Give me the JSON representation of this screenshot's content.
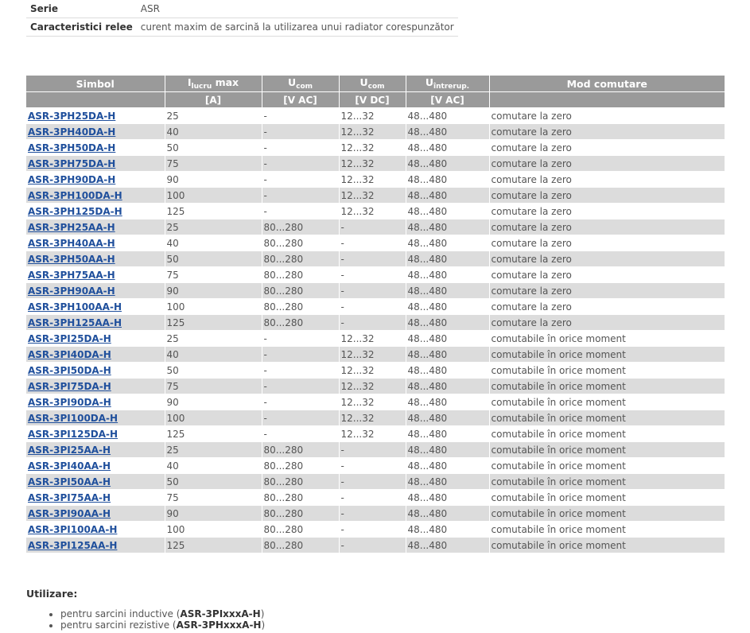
{
  "info": [
    {
      "label": "Serie",
      "value": "ASR"
    },
    {
      "label": "Caracteristici relee",
      "value": "curent maxim de sarcină la utilizarea unui radiator corespunzător"
    }
  ],
  "table": {
    "headers": {
      "simbol": "Simbol",
      "ilucru_main": "I",
      "ilucru_sub": "lucru",
      "ilucru_suffix": " max",
      "ucom_ac_main": "U",
      "ucom_ac_sub": "com",
      "ucom_dc_main": "U",
      "ucom_dc_sub": "com",
      "uintrerup_main": "U",
      "uintrerup_sub": "întrerup.",
      "mod": "Mod comutare"
    },
    "units": [
      "",
      "[A]",
      "[V AC]",
      "[V DC]",
      "[V AC]",
      ""
    ],
    "rows": [
      [
        "ASR-3PH25DA-H",
        "25",
        "-",
        "12...32",
        "48...480",
        "comutare la zero"
      ],
      [
        "ASR-3PH40DA-H",
        "40",
        "-",
        "12...32",
        "48...480",
        "comutare la zero"
      ],
      [
        "ASR-3PH50DA-H",
        "50",
        "-",
        "12...32",
        "48...480",
        "comutare la zero"
      ],
      [
        "ASR-3PH75DA-H",
        "75",
        "-",
        "12...32",
        "48...480",
        "comutare la zero"
      ],
      [
        "ASR-3PH90DA-H",
        "90",
        "-",
        "12...32",
        "48...480",
        "comutare la zero"
      ],
      [
        "ASR-3PH100DA-H",
        "100",
        "-",
        "12...32",
        "48...480",
        "comutare la zero"
      ],
      [
        "ASR-3PH125DA-H",
        "125",
        "-",
        "12...32",
        "48...480",
        "comutare la zero"
      ],
      [
        "ASR-3PH25AA-H",
        "25",
        "80...280",
        "-",
        "48...480",
        "comutare la zero"
      ],
      [
        "ASR-3PH40AA-H",
        "40",
        "80...280",
        "-",
        "48...480",
        "comutare la zero"
      ],
      [
        "ASR-3PH50AA-H",
        "50",
        "80...280",
        "-",
        "48...480",
        "comutare la zero"
      ],
      [
        "ASR-3PH75AA-H",
        "75",
        "80...280",
        "-",
        "48...480",
        "comutare la zero"
      ],
      [
        "ASR-3PH90AA-H",
        "90",
        "80...280",
        "-",
        "48...480",
        "comutare la zero"
      ],
      [
        "ASR-3PH100AA-H",
        "100",
        "80...280",
        "-",
        "48...480",
        "comutare la zero"
      ],
      [
        "ASR-3PH125AA-H",
        "125",
        "80...280",
        "-",
        "48...480",
        "comutare la zero"
      ],
      [
        "ASR-3PI25DA-H",
        "25",
        "-",
        "12...32",
        "48...480",
        "comutabile în orice moment"
      ],
      [
        "ASR-3PI40DA-H",
        "40",
        "-",
        "12...32",
        "48...480",
        "comutabile în orice moment"
      ],
      [
        "ASR-3PI50DA-H",
        "50",
        "-",
        "12...32",
        "48...480",
        "comutabile în orice moment"
      ],
      [
        "ASR-3PI75DA-H",
        "75",
        "-",
        "12...32",
        "48...480",
        "comutabile în orice moment"
      ],
      [
        "ASR-3PI90DA-H",
        "90",
        "-",
        "12...32",
        "48...480",
        "comutabile în orice moment"
      ],
      [
        "ASR-3PI100DA-H",
        "100",
        "-",
        "12...32",
        "48...480",
        "comutabile în orice moment"
      ],
      [
        "ASR-3PI125DA-H",
        "125",
        "-",
        "12...32",
        "48...480",
        "comutabile în orice moment"
      ],
      [
        "ASR-3PI25AA-H",
        "25",
        "80...280",
        "-",
        "48...480",
        "comutabile în orice moment"
      ],
      [
        "ASR-3PI40AA-H",
        "40",
        "80...280",
        "-",
        "48...480",
        "comutabile în orice moment"
      ],
      [
        "ASR-3PI50AA-H",
        "50",
        "80...280",
        "-",
        "48...480",
        "comutabile în orice moment"
      ],
      [
        "ASR-3PI75AA-H",
        "75",
        "80...280",
        "-",
        "48...480",
        "comutabile în orice moment"
      ],
      [
        "ASR-3PI90AA-H",
        "90",
        "80...280",
        "-",
        "48...480",
        "comutabile în orice moment"
      ],
      [
        "ASR-3PI100AA-H",
        "100",
        "80...280",
        "-",
        "48...480",
        "comutabile în orice moment"
      ],
      [
        "ASR-3PI125AA-H",
        "125",
        "80...280",
        "-",
        "48...480",
        "comutabile în orice moment"
      ]
    ]
  },
  "usage": {
    "title": "Utilizare:",
    "items": [
      {
        "text": "pentru sarcini inductive (",
        "code": "ASR-3PIxxxA-H",
        "end": ")"
      },
      {
        "text": "pentru sarcini rezistive (",
        "code": "ASR-3PHxxxA-H",
        "end": ")"
      }
    ]
  },
  "colors": {
    "header_bg": "#9a9a9a",
    "row_alt_bg": "#dcdcdc",
    "link": "#1f4f9c"
  }
}
